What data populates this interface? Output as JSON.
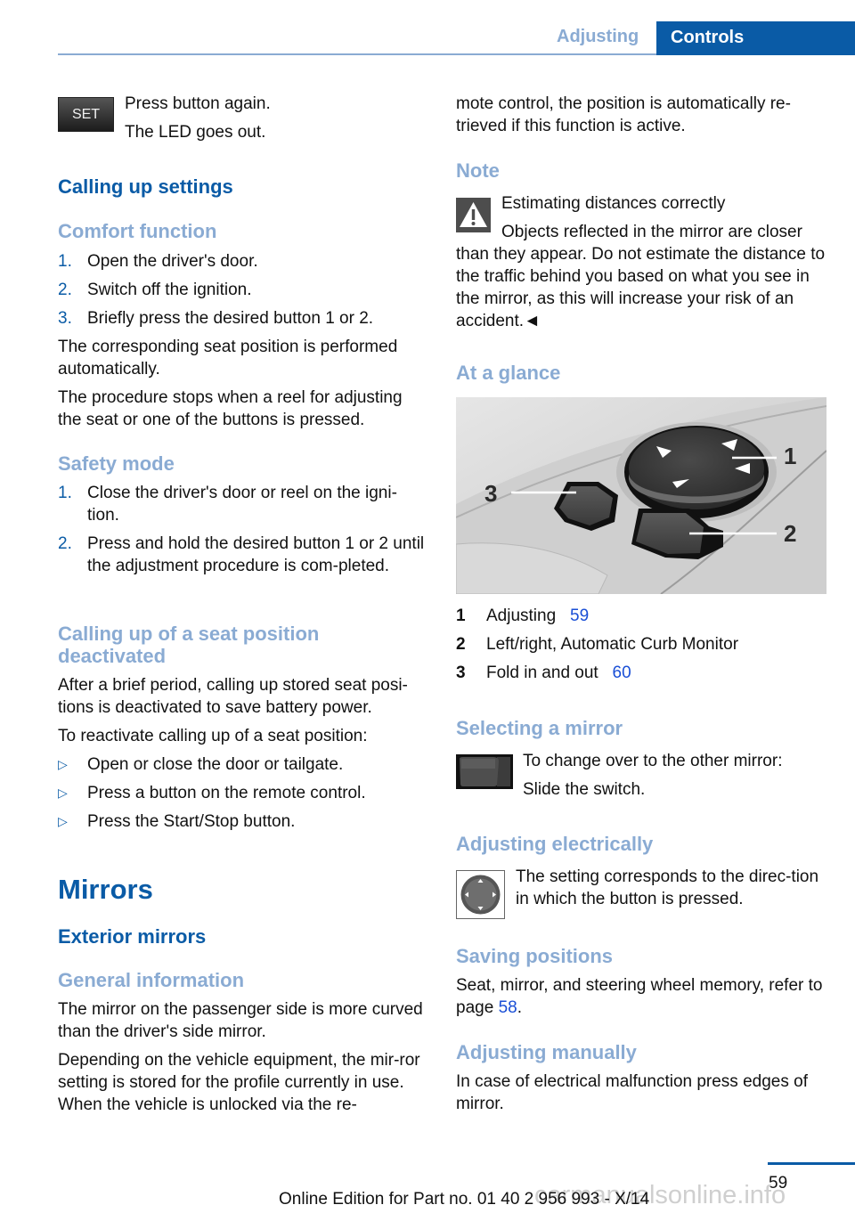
{
  "header": {
    "section_tab": "Adjusting",
    "chapter_tab": "Controls"
  },
  "left": {
    "set_icon_label": "SET",
    "set_lines": [
      "Press button again.",
      "The LED goes out."
    ],
    "calling_up_heading": "Calling up settings",
    "comfort_heading": "Comfort function",
    "comfort_steps": [
      {
        "num": "1.",
        "text": "Open the driver's door."
      },
      {
        "num": "2.",
        "text": "Switch off the ignition."
      },
      {
        "num": "3.",
        "text": "Briefly press the desired button 1 or 2."
      }
    ],
    "comfort_p1": "The corresponding seat position is performed automatically.",
    "comfort_p2": "The procedure stops when a reel for adjusting the seat or one of the buttons is pressed.",
    "safety_heading": "Safety mode",
    "safety_steps": [
      {
        "num": "1.",
        "text": "Close the driver's door or reel on the igni-tion."
      },
      {
        "num": "2.",
        "text": "Press and hold the desired button 1 or 2 until the adjustment procedure is com-pleted."
      }
    ],
    "deactivated_heading": "Calling up of a seat position deactivated",
    "deactivated_p1": "After a brief period, calling up stored seat posi-tions is deactivated to save battery power.",
    "deactivated_p2": "To reactivate calling up of a seat position:",
    "reactivate_bullets": [
      "Open or close the door or tailgate.",
      "Press a button on the remote control.",
      "Press the Start/Stop button."
    ],
    "mirrors_heading": "Mirrors",
    "exterior_heading": "Exterior mirrors",
    "general_heading": "General information",
    "general_p1": "The mirror on the passenger side is more curved than the driver's side mirror.",
    "general_p2": "Depending on the vehicle equipment, the mir-ror setting is stored for the profile currently in use. When the vehicle is unlocked via the re-"
  },
  "right": {
    "continued_p": "mote control, the position is automatically re-trieved if this function is active.",
    "note_heading": "Note",
    "note_title": "Estimating distances correctly",
    "note_body": "Objects reflected in the mirror are closer than they appear. Do not estimate the distance to the traffic behind you based on what you see in the mirror, as this will increase your risk of an accident.◄",
    "glance_heading": "At a glance",
    "photo_callouts": [
      "1",
      "2",
      "3"
    ],
    "legend": [
      {
        "num": "1",
        "text": "Adjusting",
        "page": "59"
      },
      {
        "num": "2",
        "text": "Left/right, Automatic Curb Monitor",
        "page": ""
      },
      {
        "num": "3",
        "text": "Fold in and out",
        "page": "60"
      }
    ],
    "selecting_heading": "Selecting a mirror",
    "selecting_lines": [
      "To change over to the other mirror:",
      "Slide the switch."
    ],
    "electrically_heading": "Adjusting electrically",
    "electrically_text": "The setting corresponds to the direc-tion in which the button is pressed.",
    "saving_heading": "Saving positions",
    "saving_text": "Seat, mirror, and steering wheel memory, refer to page",
    "saving_page": "58",
    "saving_end": ".",
    "manually_heading": "Adjusting manually",
    "manually_text": "In case of electrical malfunction press edges of mirror."
  },
  "footer": {
    "page_number": "59",
    "edition": "Online Edition for Part no. 01 40 2 956 993 - X/14",
    "watermark": "carmanualsonline.info"
  },
  "colors": {
    "brand_blue": "#0a5ba6",
    "light_blue": "#8aabd3",
    "link_blue": "#1a4fd6"
  }
}
